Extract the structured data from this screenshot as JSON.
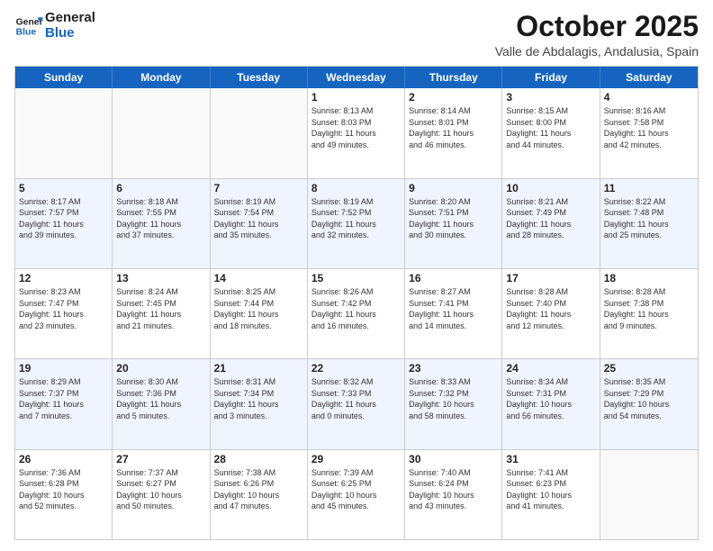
{
  "logo": {
    "line1": "General",
    "line2": "Blue"
  },
  "title": "October 2025",
  "location": "Valle de Abdalagis, Andalusia, Spain",
  "dayHeaders": [
    "Sunday",
    "Monday",
    "Tuesday",
    "Wednesday",
    "Thursday",
    "Friday",
    "Saturday"
  ],
  "weeks": [
    [
      {
        "day": "",
        "info": ""
      },
      {
        "day": "",
        "info": ""
      },
      {
        "day": "",
        "info": ""
      },
      {
        "day": "1",
        "info": "Sunrise: 8:13 AM\nSunset: 8:03 PM\nDaylight: 11 hours\nand 49 minutes."
      },
      {
        "day": "2",
        "info": "Sunrise: 8:14 AM\nSunset: 8:01 PM\nDaylight: 11 hours\nand 46 minutes."
      },
      {
        "day": "3",
        "info": "Sunrise: 8:15 AM\nSunset: 8:00 PM\nDaylight: 11 hours\nand 44 minutes."
      },
      {
        "day": "4",
        "info": "Sunrise: 8:16 AM\nSunset: 7:58 PM\nDaylight: 11 hours\nand 42 minutes."
      }
    ],
    [
      {
        "day": "5",
        "info": "Sunrise: 8:17 AM\nSunset: 7:57 PM\nDaylight: 11 hours\nand 39 minutes."
      },
      {
        "day": "6",
        "info": "Sunrise: 8:18 AM\nSunset: 7:55 PM\nDaylight: 11 hours\nand 37 minutes."
      },
      {
        "day": "7",
        "info": "Sunrise: 8:19 AM\nSunset: 7:54 PM\nDaylight: 11 hours\nand 35 minutes."
      },
      {
        "day": "8",
        "info": "Sunrise: 8:19 AM\nSunset: 7:52 PM\nDaylight: 11 hours\nand 32 minutes."
      },
      {
        "day": "9",
        "info": "Sunrise: 8:20 AM\nSunset: 7:51 PM\nDaylight: 11 hours\nand 30 minutes."
      },
      {
        "day": "10",
        "info": "Sunrise: 8:21 AM\nSunset: 7:49 PM\nDaylight: 11 hours\nand 28 minutes."
      },
      {
        "day": "11",
        "info": "Sunrise: 8:22 AM\nSunset: 7:48 PM\nDaylight: 11 hours\nand 25 minutes."
      }
    ],
    [
      {
        "day": "12",
        "info": "Sunrise: 8:23 AM\nSunset: 7:47 PM\nDaylight: 11 hours\nand 23 minutes."
      },
      {
        "day": "13",
        "info": "Sunrise: 8:24 AM\nSunset: 7:45 PM\nDaylight: 11 hours\nand 21 minutes."
      },
      {
        "day": "14",
        "info": "Sunrise: 8:25 AM\nSunset: 7:44 PM\nDaylight: 11 hours\nand 18 minutes."
      },
      {
        "day": "15",
        "info": "Sunrise: 8:26 AM\nSunset: 7:42 PM\nDaylight: 11 hours\nand 16 minutes."
      },
      {
        "day": "16",
        "info": "Sunrise: 8:27 AM\nSunset: 7:41 PM\nDaylight: 11 hours\nand 14 minutes."
      },
      {
        "day": "17",
        "info": "Sunrise: 8:28 AM\nSunset: 7:40 PM\nDaylight: 11 hours\nand 12 minutes."
      },
      {
        "day": "18",
        "info": "Sunrise: 8:28 AM\nSunset: 7:38 PM\nDaylight: 11 hours\nand 9 minutes."
      }
    ],
    [
      {
        "day": "19",
        "info": "Sunrise: 8:29 AM\nSunset: 7:37 PM\nDaylight: 11 hours\nand 7 minutes."
      },
      {
        "day": "20",
        "info": "Sunrise: 8:30 AM\nSunset: 7:36 PM\nDaylight: 11 hours\nand 5 minutes."
      },
      {
        "day": "21",
        "info": "Sunrise: 8:31 AM\nSunset: 7:34 PM\nDaylight: 11 hours\nand 3 minutes."
      },
      {
        "day": "22",
        "info": "Sunrise: 8:32 AM\nSunset: 7:33 PM\nDaylight: 11 hours\nand 0 minutes."
      },
      {
        "day": "23",
        "info": "Sunrise: 8:33 AM\nSunset: 7:32 PM\nDaylight: 10 hours\nand 58 minutes."
      },
      {
        "day": "24",
        "info": "Sunrise: 8:34 AM\nSunset: 7:31 PM\nDaylight: 10 hours\nand 56 minutes."
      },
      {
        "day": "25",
        "info": "Sunrise: 8:35 AM\nSunset: 7:29 PM\nDaylight: 10 hours\nand 54 minutes."
      }
    ],
    [
      {
        "day": "26",
        "info": "Sunrise: 7:36 AM\nSunset: 6:28 PM\nDaylight: 10 hours\nand 52 minutes."
      },
      {
        "day": "27",
        "info": "Sunrise: 7:37 AM\nSunset: 6:27 PM\nDaylight: 10 hours\nand 50 minutes."
      },
      {
        "day": "28",
        "info": "Sunrise: 7:38 AM\nSunset: 6:26 PM\nDaylight: 10 hours\nand 47 minutes."
      },
      {
        "day": "29",
        "info": "Sunrise: 7:39 AM\nSunset: 6:25 PM\nDaylight: 10 hours\nand 45 minutes."
      },
      {
        "day": "30",
        "info": "Sunrise: 7:40 AM\nSunset: 6:24 PM\nDaylight: 10 hours\nand 43 minutes."
      },
      {
        "day": "31",
        "info": "Sunrise: 7:41 AM\nSunset: 6:23 PM\nDaylight: 10 hours\nand 41 minutes."
      },
      {
        "day": "",
        "info": ""
      }
    ]
  ]
}
